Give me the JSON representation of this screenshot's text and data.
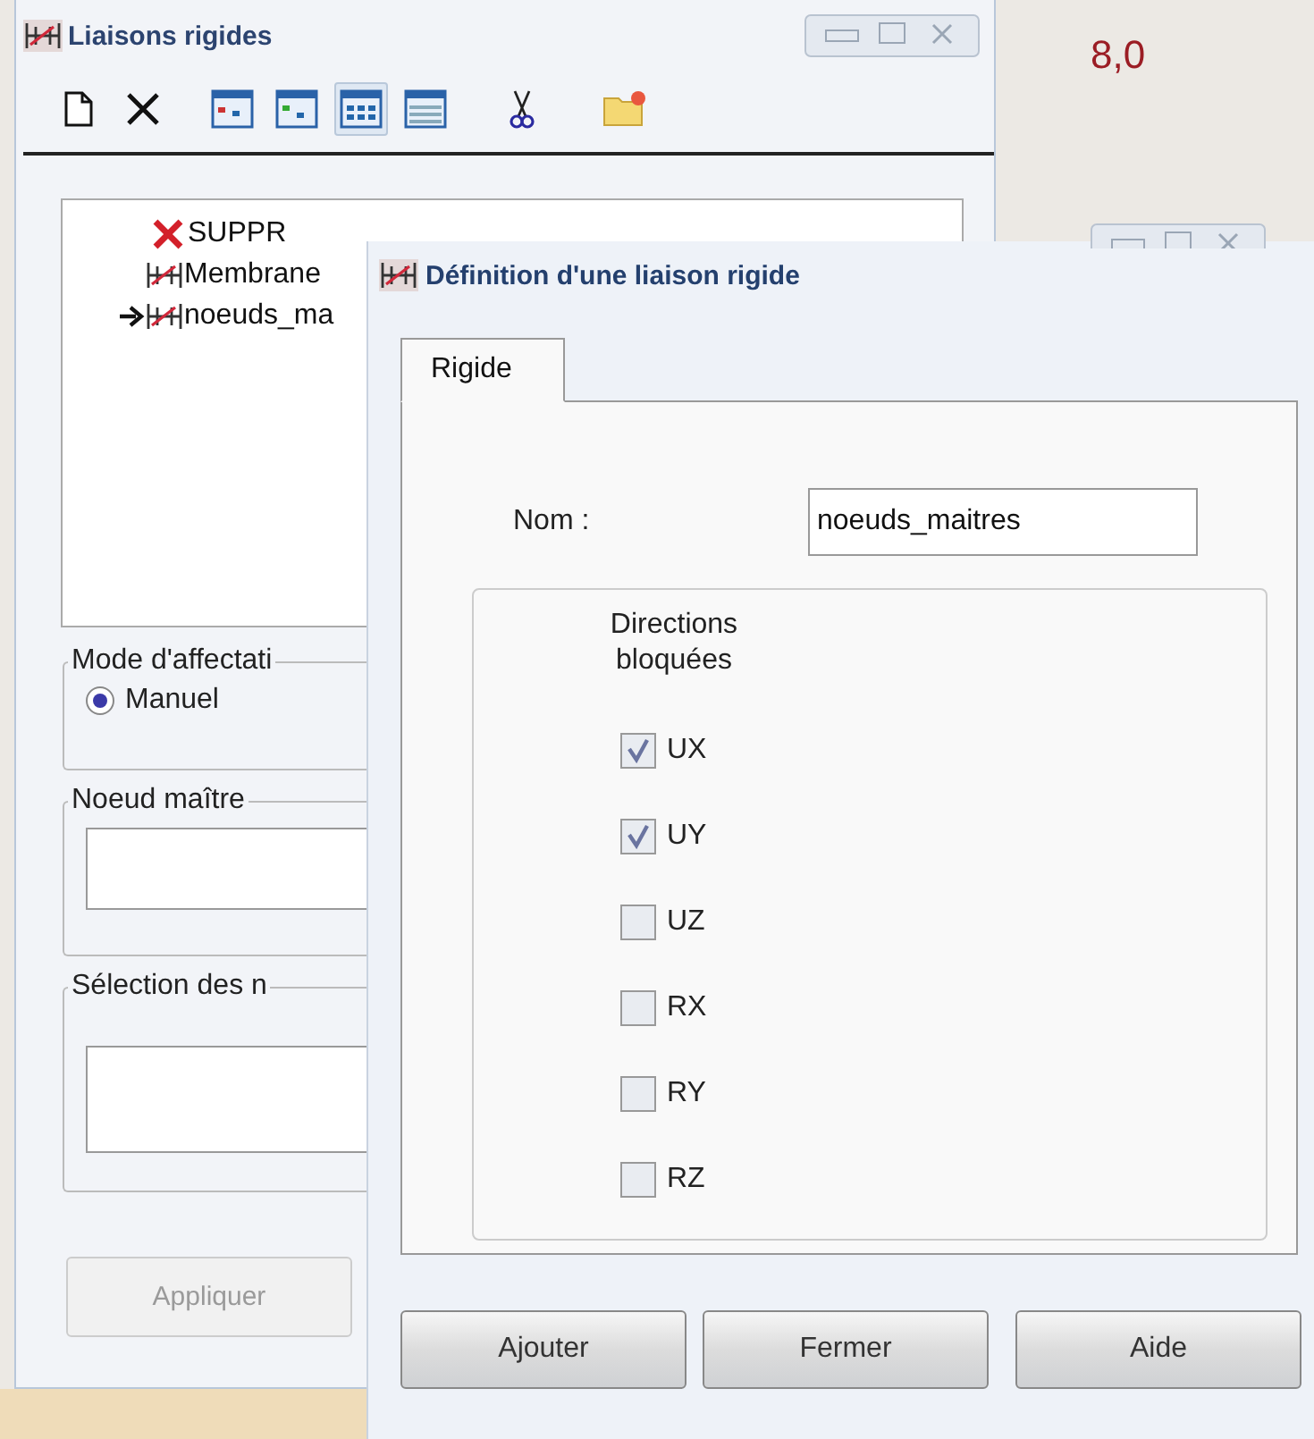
{
  "canvas": {
    "label": "8,0"
  },
  "window": {
    "title": "Liaisons rigides"
  },
  "toolbar": [
    {
      "kind": "new",
      "selected": false
    },
    {
      "kind": "delete",
      "selected": false
    },
    {
      "kind": "table-a",
      "selected": false
    },
    {
      "kind": "table-b",
      "selected": false
    },
    {
      "kind": "table-c",
      "selected": true
    },
    {
      "kind": "table-d",
      "selected": false
    },
    {
      "kind": "cut",
      "selected": false
    },
    {
      "kind": "folder",
      "selected": false
    }
  ],
  "tree": [
    {
      "label": "SUPPR",
      "kind": "deleted",
      "current": false
    },
    {
      "label": "Membrane",
      "kind": "link",
      "current": false
    },
    {
      "label": "noeuds_ma",
      "kind": "link",
      "current": true
    }
  ],
  "mode_group": {
    "title": "Mode d'affectati",
    "options": [
      {
        "label": "Manuel",
        "selected": true
      }
    ]
  },
  "master_node": {
    "title": "Noeud maître"
  },
  "node_selection": {
    "title": "Sélection des n"
  },
  "apply_button": {
    "label": "Appliquer",
    "disabled": true
  },
  "dialog": {
    "title": "Définition d'une liaison rigide",
    "tabs": [
      {
        "label": "Rigide",
        "selected": true
      }
    ],
    "name_label": "Nom :",
    "name_value": "noeuds_maitres",
    "directions_title": "Directions bloquées",
    "directions": [
      {
        "label": "UX",
        "checked": true
      },
      {
        "label": "UY",
        "checked": true
      },
      {
        "label": "UZ",
        "checked": false
      },
      {
        "label": "RX",
        "checked": false
      },
      {
        "label": "RY",
        "checked": false
      },
      {
        "label": "RZ",
        "checked": false
      }
    ],
    "buttons": [
      "Ajouter",
      "Fermer",
      "Aide"
    ]
  }
}
